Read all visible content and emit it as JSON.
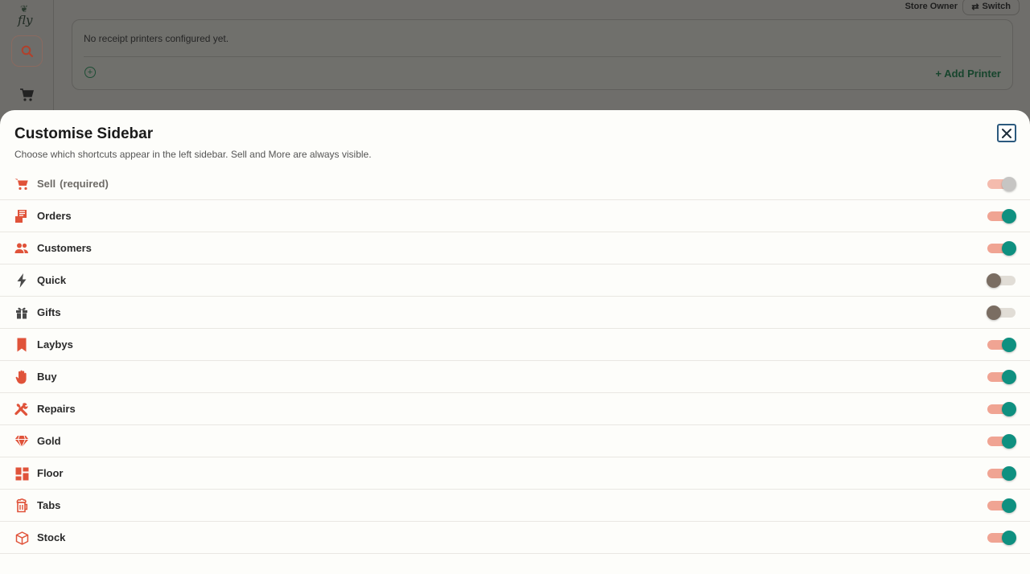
{
  "background": {
    "brand": "fly",
    "user_role": "Store Owner",
    "switch_label": "Switch",
    "printers_message": "No receipt printers configured yet.",
    "add_printer_label": "+ Add Printer"
  },
  "sheet": {
    "title": "Customise Sidebar",
    "subtitle": "Choose which shortcuts appear in the left sidebar. Sell and More are always visible.",
    "close_icon": "close-icon"
  },
  "items": [
    {
      "label": "Sell",
      "note": "(required)",
      "icon": "cart-icon",
      "state": "disabled-on"
    },
    {
      "label": "Orders",
      "icon": "receipt-icon",
      "state": "on"
    },
    {
      "label": "Customers",
      "icon": "people-icon",
      "state": "on"
    },
    {
      "label": "Quick",
      "icon": "bolt-icon",
      "state": "off"
    },
    {
      "label": "Gifts",
      "icon": "gift-icon",
      "state": "off"
    },
    {
      "label": "Laybys",
      "icon": "bookmark-icon",
      "state": "on"
    },
    {
      "label": "Buy",
      "icon": "hand-icon",
      "state": "on"
    },
    {
      "label": "Repairs",
      "icon": "tools-icon",
      "state": "on"
    },
    {
      "label": "Gold",
      "icon": "gem-icon",
      "state": "on"
    },
    {
      "label": "Floor",
      "icon": "grid-icon",
      "state": "on"
    },
    {
      "label": "Tabs",
      "icon": "beer-mug-icon",
      "state": "on"
    },
    {
      "label": "Stock",
      "icon": "box-icon",
      "state": "on"
    }
  ],
  "colors": {
    "accent_icon": "#e0533a",
    "toggle_on_knob": "#0f9080",
    "toggle_on_track": "#f0a493",
    "toggle_off_knob": "#7a6d62"
  }
}
